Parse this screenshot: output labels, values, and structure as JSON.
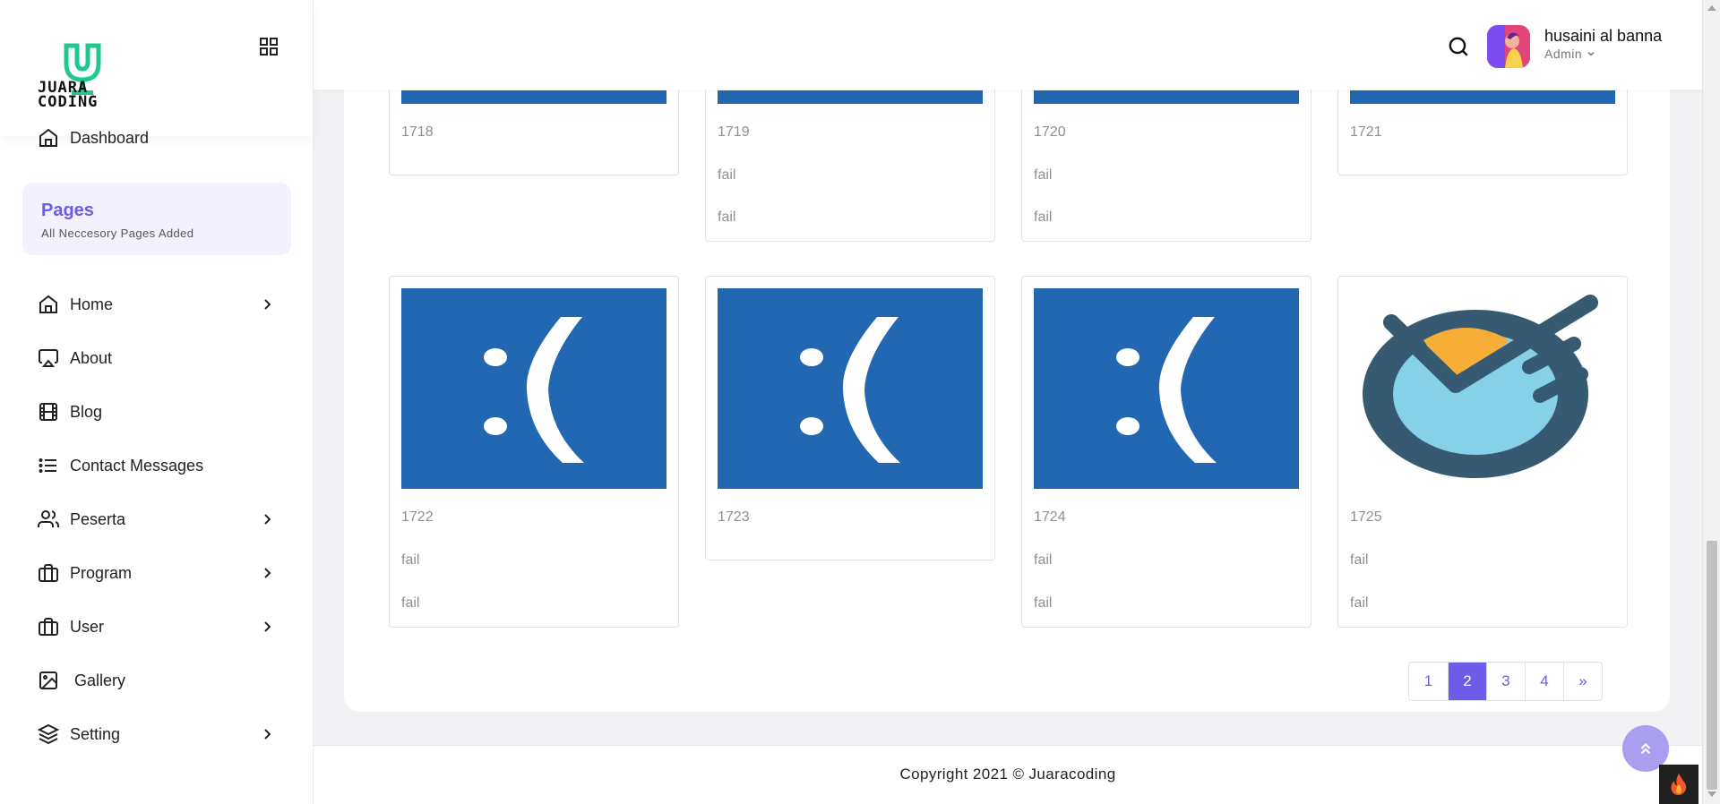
{
  "brand": {
    "logo_line1": "JUARA",
    "logo_line2": "CODING",
    "logo_color": "#1fc98e"
  },
  "sidebar": {
    "dashboard_label": "Dashboard",
    "pages_title": "Pages",
    "pages_subtitle": "All Neccesory Pages Added",
    "items": [
      {
        "label": "Home",
        "icon": "home-icon",
        "has_submenu": true
      },
      {
        "label": "About",
        "icon": "airplay-icon",
        "has_submenu": false
      },
      {
        "label": "Blog",
        "icon": "film-icon",
        "has_submenu": false
      },
      {
        "label": "Contact Messages",
        "icon": "list-icon",
        "has_submenu": false
      },
      {
        "label": "Peserta",
        "icon": "users-icon",
        "has_submenu": true
      },
      {
        "label": "Program",
        "icon": "briefcase-icon",
        "has_submenu": true
      },
      {
        "label": "User",
        "icon": "briefcase-icon",
        "has_submenu": true
      },
      {
        "label": "Gallery",
        "icon": "image-icon",
        "has_submenu": false
      },
      {
        "label": "Setting",
        "icon": "layers-icon",
        "has_submenu": true
      }
    ]
  },
  "header": {
    "user_name": "husaini al banna",
    "user_role": "Admin"
  },
  "gallery": {
    "cards": [
      {
        "id": "1718",
        "line1": "",
        "line2": "",
        "image": "error"
      },
      {
        "id": "1719",
        "line1": "fail",
        "line2": "fail",
        "image": "error"
      },
      {
        "id": "1720",
        "line1": "fail",
        "line2": "fail",
        "image": "error"
      },
      {
        "id": "1721",
        "line1": "",
        "line2": "",
        "image": "error"
      },
      {
        "id": "1722",
        "line1": "fail",
        "line2": "fail",
        "image": "error"
      },
      {
        "id": "1723",
        "line1": "",
        "line2": "",
        "image": "error"
      },
      {
        "id": "1724",
        "line1": "fail",
        "line2": "fail",
        "image": "error"
      },
      {
        "id": "1725",
        "line1": "fail",
        "line2": "fail",
        "image": "logo"
      }
    ]
  },
  "pagination": {
    "pages": [
      "1",
      "2",
      "3",
      "4"
    ],
    "current": "2",
    "next_label": "»"
  },
  "footer": {
    "copyright": "Copyright 2021 © Juaracoding"
  },
  "colors": {
    "accent": "#6c5ce7",
    "error_blue": "#2167b1"
  }
}
